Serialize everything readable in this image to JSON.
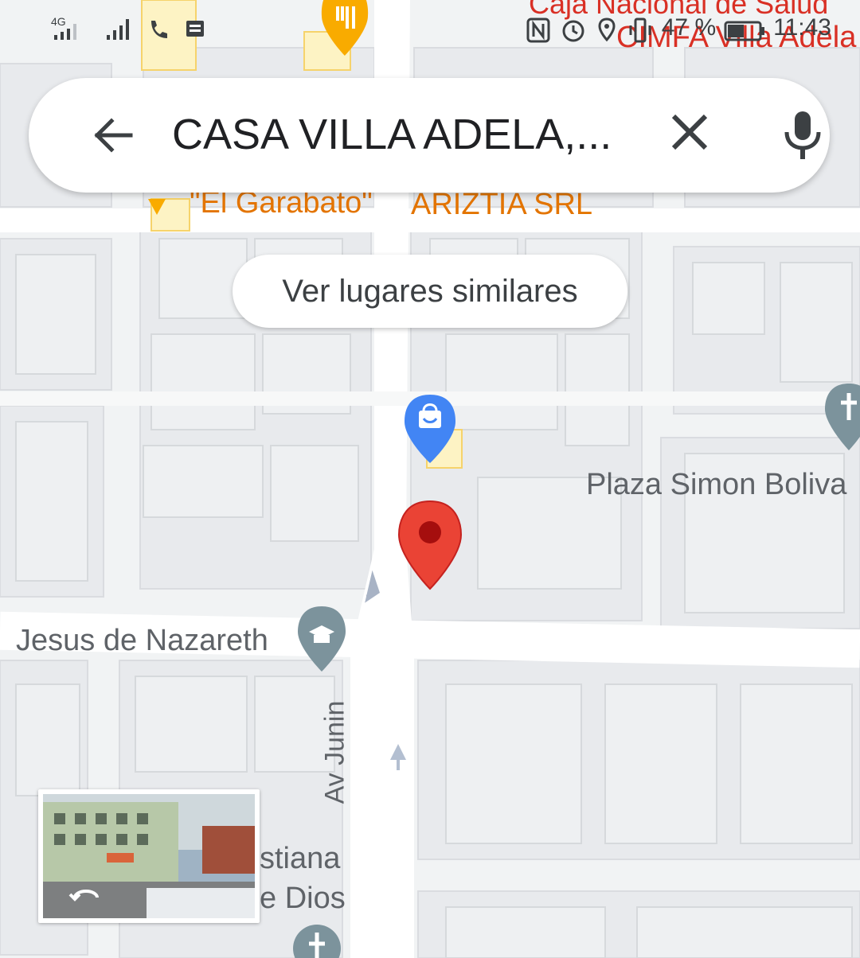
{
  "status_bar": {
    "network": "4G",
    "battery": "47 %",
    "time": "11:43"
  },
  "search": {
    "query": "CASA VILLA ADELA,...",
    "back_icon": "arrow-back-icon",
    "clear_icon": "close-icon",
    "voice_icon": "mic-icon"
  },
  "chip": {
    "label": "Ver lugares similares"
  },
  "map": {
    "places": {
      "top_right_1": "Caja Nacional de Salud",
      "top_right_2": "CIMFA Villa Adela",
      "garabato": "\"El Garabato\"",
      "arizt": "ARIZTIA SRL",
      "plaza": "Plaza Simon Boliva",
      "jesus": "Jesus de Nazareth",
      "street": "Av Junin",
      "bottom_1": "stiana",
      "bottom_2": "e Dios"
    },
    "colors": {
      "pin_red": "#ea4335",
      "pin_blue": "#4285f4",
      "pin_orange": "#f9ab00",
      "pin_gray": "#7c939c"
    }
  },
  "street_view": {
    "icon": "rotate-360-icon"
  }
}
